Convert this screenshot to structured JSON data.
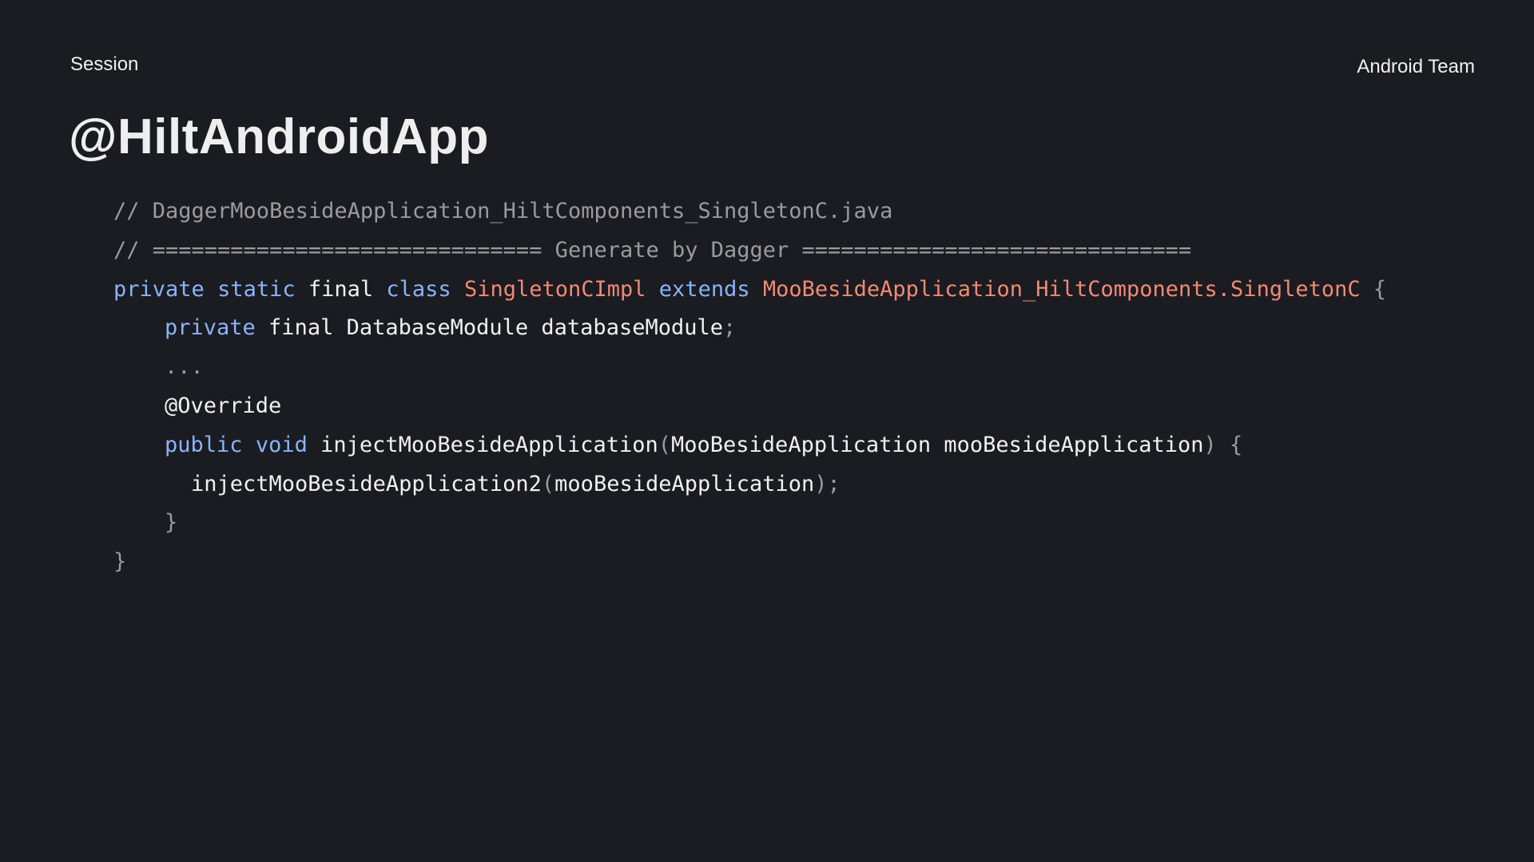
{
  "header": {
    "session_label": "Session",
    "team_label": "Android Team"
  },
  "title": "@HiltAndroidApp",
  "colors": {
    "background": "#1b1b22",
    "keyword": "#8ab4f8",
    "type": "#f08a74",
    "comment": "#9a9a9f",
    "text": "#f1f1f1"
  },
  "code": {
    "lines": [
      {
        "indent": 0,
        "tokens": [
          {
            "text": "// DaggerMooBesideApplication_HiltComponents_SingletonC.java",
            "kind": "comment"
          }
        ]
      },
      {
        "indent": 0,
        "tokens": [
          {
            "text": "// ============================== Generate by Dagger ==============================",
            "kind": "comment"
          }
        ]
      },
      {
        "indent": 0,
        "tokens": [
          {
            "text": "private",
            "kind": "keyword"
          },
          {
            "text": " ",
            "kind": "plain"
          },
          {
            "text": "static",
            "kind": "keyword"
          },
          {
            "text": " final ",
            "kind": "plain"
          },
          {
            "text": "class",
            "kind": "keyword"
          },
          {
            "text": " ",
            "kind": "plain"
          },
          {
            "text": "SingletonCImpl",
            "kind": "type"
          },
          {
            "text": " ",
            "kind": "plain"
          },
          {
            "text": "extends",
            "kind": "keyword"
          },
          {
            "text": " ",
            "kind": "plain"
          },
          {
            "text": "MooBesideApplication_HiltComponents.SingletonC",
            "kind": "type"
          },
          {
            "text": " {",
            "kind": "punct"
          }
        ]
      },
      {
        "indent": 1,
        "tokens": [
          {
            "text": "private",
            "kind": "keyword"
          },
          {
            "text": " final DatabaseModule databaseModule",
            "kind": "plain"
          },
          {
            "text": ";",
            "kind": "punct"
          }
        ]
      },
      {
        "indent": 1,
        "tokens": [
          {
            "text": "...",
            "kind": "punct"
          }
        ]
      },
      {
        "indent": 1,
        "tokens": [
          {
            "text": "@Override",
            "kind": "plain"
          }
        ]
      },
      {
        "indent": 1,
        "tokens": [
          {
            "text": "public",
            "kind": "keyword"
          },
          {
            "text": " ",
            "kind": "plain"
          },
          {
            "text": "void",
            "kind": "keyword"
          },
          {
            "text": " injectMooBesideApplication",
            "kind": "plain"
          },
          {
            "text": "(",
            "kind": "punct"
          },
          {
            "text": "MooBesideApplication mooBesideApplication",
            "kind": "plain"
          },
          {
            "text": ") {",
            "kind": "punct"
          }
        ]
      },
      {
        "indent": 2,
        "tokens": [
          {
            "text": "injectMooBesideApplication2",
            "kind": "plain"
          },
          {
            "text": "(",
            "kind": "punct"
          },
          {
            "text": "mooBesideApplication",
            "kind": "plain"
          },
          {
            "text": ");",
            "kind": "punct"
          }
        ]
      },
      {
        "indent": 1,
        "tokens": [
          {
            "text": "}",
            "kind": "punct"
          }
        ]
      },
      {
        "indent": 0,
        "tokens": [
          {
            "text": "}",
            "kind": "punct"
          }
        ]
      }
    ]
  }
}
